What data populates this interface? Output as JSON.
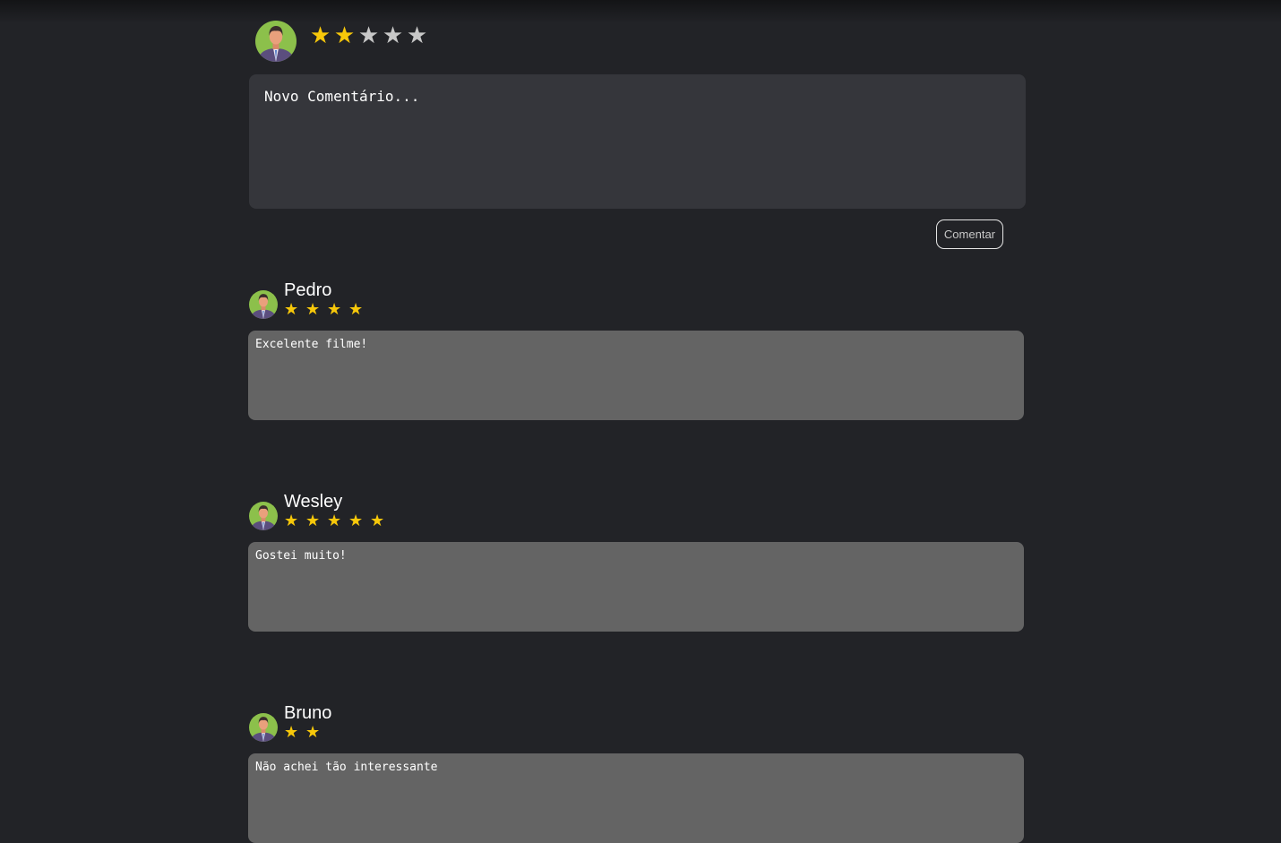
{
  "composer": {
    "rating": 2,
    "max_rating": 5,
    "star_glyph": "★",
    "placeholder": "Novo Comentário...",
    "submit_label": "Comentar",
    "avatar_icon": "user-avatar-icon"
  },
  "colors": {
    "background": "#222327",
    "input_background": "#35363b",
    "comment_background": "#646464",
    "star_filled": "#f7c80a",
    "star_empty": "#c8c8c8"
  },
  "comments": [
    {
      "author": "Pedro",
      "rating": 4,
      "text": "Excelente filme!"
    },
    {
      "author": "Wesley",
      "rating": 5,
      "text": "Gostei muito!"
    },
    {
      "author": "Bruno",
      "rating": 2,
      "text": "Não achei tão interessante"
    }
  ]
}
